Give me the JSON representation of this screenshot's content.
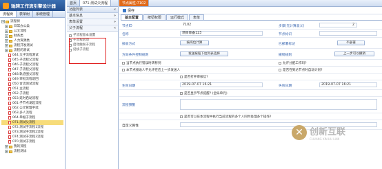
{
  "app_title": "驰骋工作流引擎设计器",
  "left_tabs": [
    "流程树",
    "表单树",
    "系统管理"
  ],
  "tree": [
    {
      "label": "流程树",
      "indent": 0,
      "type": "folder"
    },
    {
      "label": "日常办公类",
      "indent": 1,
      "type": "folder"
    },
    {
      "label": "公文流程",
      "indent": 1,
      "type": "folder"
    },
    {
      "label": "财务类",
      "indent": 1,
      "type": "folder"
    },
    {
      "label": "人力资源类",
      "indent": 1,
      "type": "folder"
    },
    {
      "label": "流程开发测试",
      "indent": 1,
      "type": "folder"
    },
    {
      "label": "流程的测试",
      "indent": 1,
      "type": "folder"
    },
    {
      "label": "044.父子流程测试",
      "indent": 2,
      "type": "doc"
    },
    {
      "label": "045.子流程父流程",
      "indent": 2,
      "type": "doc"
    },
    {
      "label": "046.子流程父流程",
      "indent": 2,
      "type": "doc"
    },
    {
      "label": "047.子流程父流程",
      "indent": 2,
      "type": "doc"
    },
    {
      "label": "048.轨迹图父流程",
      "indent": 2,
      "type": "doc"
    },
    {
      "label": "049.审批流程退回",
      "indent": 2,
      "type": "doc"
    },
    {
      "label": "050.合流测试流程",
      "indent": 2,
      "type": "doc"
    },
    {
      "label": "051.主流程",
      "indent": 2,
      "type": "doc"
    },
    {
      "label": "052.子流程",
      "indent": 2,
      "type": "doc"
    },
    {
      "label": "053.延时启动流程",
      "indent": 2,
      "type": "doc"
    },
    {
      "label": "061.子节点发起流程",
      "indent": 2,
      "type": "doc"
    },
    {
      "label": "062.公文管理手续",
      "indent": 2,
      "type": "doc"
    },
    {
      "label": "063.多人流程",
      "indent": 2,
      "type": "doc"
    },
    {
      "label": "064.单据子流程",
      "indent": 2,
      "type": "doc"
    },
    {
      "label": "071.测试父流程",
      "indent": 2,
      "type": "doc",
      "selected": true
    },
    {
      "label": "072.测试子流程1流程",
      "indent": 2,
      "type": "doc"
    },
    {
      "label": "073.测试子流程2流程",
      "indent": 2,
      "type": "doc"
    },
    {
      "label": "074.测试子流程3流程",
      "indent": 2,
      "type": "doc"
    },
    {
      "label": "070.测试子流程",
      "indent": 2,
      "type": "doc"
    },
    {
      "label": "我的流程",
      "indent": 1,
      "type": "folder"
    },
    {
      "label": "流程测试",
      "indent": 1,
      "type": "folder"
    }
  ],
  "mid": {
    "tabs": [
      "首页",
      "071.测试父流程"
    ],
    "header": "功能列表",
    "sections": [
      "基本信息",
      "表单设置",
      "父子流程"
    ],
    "items": [
      "子流程基本设置",
      "子流程启动",
      "启动触发子流程",
      "延续子流程"
    ]
  },
  "main": {
    "tab": "节点属性:7102",
    "save_label": "保存",
    "subtabs": [
      "基本配置",
      "按钮权限",
      "运行模式",
      "表单"
    ],
    "fields": {
      "node_id_label": "节点ID",
      "node_id": "7102",
      "step_label": "步骤(无计算意义)",
      "step_value": "2",
      "name_label": "名称",
      "name_value": "项目筹备123",
      "node_sign_label": "节点标识",
      "node_sign_value": "",
      "reach_label": "接收方式",
      "reach_value": "按岗位计算",
      "dept_label": "已部署标记",
      "dept_value": "不部署",
      "dir_label": "方向条件控制规则",
      "dir_value": "发送按钮下拉列表选择",
      "mode_label": "撤销规则",
      "mode_value": "上一步可以撤销",
      "chk1": "当节点执行错误时转移到",
      "chk2": "允许分配工作吗?",
      "chk3": "本节点接收人不允许在应上一步发送人",
      "chk4": "是否在到达节点时自动计划?",
      "chk5": "是否打开审核信?",
      "date1_label": "生效日期",
      "date1_value": "2019-07-07 16:21",
      "date2_label": "失效日期",
      "date2_value": "2019-07-07 16:21",
      "chk6": "是否显示节点提醒?",
      "chk6_hint": "(全局单元)",
      "remark_label": "流程预警",
      "chk7": "是否可以在本流程中执行当前流程的多个人同时处理多个操作?",
      "custom_label": "自定义属性"
    }
  },
  "watermark": {
    "brand": "创新互联",
    "sub": "CHUANG XIN HU LIAN"
  }
}
